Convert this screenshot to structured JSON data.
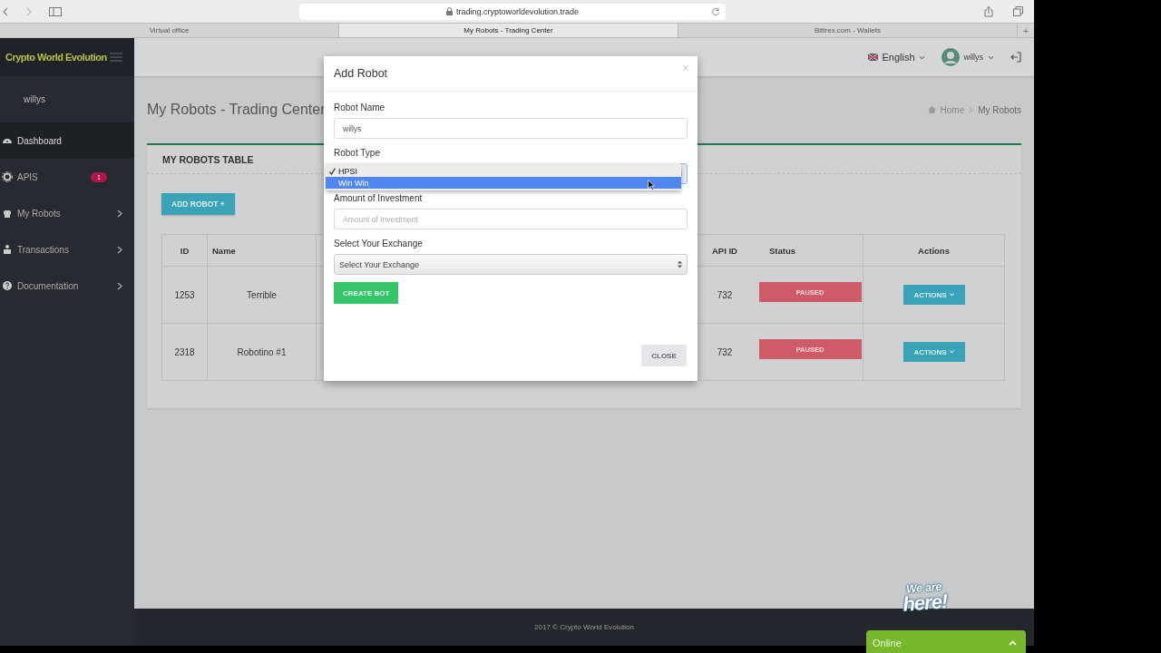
{
  "browser": {
    "url": "trading.cryptoworldevolution.trade",
    "tabs": [
      {
        "label": "Virtual office",
        "selected": false
      },
      {
        "label": "My Robots - Trading Center",
        "selected": true
      },
      {
        "label": "Bittrex.com - Wallets",
        "selected": false
      }
    ],
    "new_tab": "+"
  },
  "sidebar": {
    "brand": "Crypto World Evolution",
    "user": "willys",
    "items": [
      {
        "label": "Dashboard",
        "selected": true,
        "expandable": false
      },
      {
        "label": "APIS",
        "selected": false,
        "badge": "1",
        "expandable": false
      },
      {
        "label": "My Robots",
        "selected": false,
        "expandable": true
      },
      {
        "label": "Transactions",
        "selected": false,
        "expandable": true
      },
      {
        "label": "Documentation",
        "selected": false,
        "expandable": true
      }
    ]
  },
  "header": {
    "language": "English",
    "user": "willys"
  },
  "page": {
    "title": "My Robots - Trading Center",
    "breadcrumb": [
      "Home",
      "My Robots"
    ]
  },
  "card": {
    "title": "MY ROBOTS TABLE",
    "add_button": "ADD ROBOT +",
    "table": {
      "columns": [
        "ID",
        "Name",
        "API ID",
        "Status",
        "Actions"
      ],
      "rows": [
        {
          "id": "1253",
          "name": "Terrible",
          "api_id": "732",
          "status": "PAUSED",
          "action": "ACTIONS"
        },
        {
          "id": "2318",
          "name": "Robotino #1",
          "api_id": "732",
          "status": "PAUSED",
          "action": "ACTIONS"
        }
      ]
    }
  },
  "modal": {
    "title": "Add Robot",
    "close_icon": "×",
    "fields": [
      {
        "kind": "text",
        "label": "Robot Name",
        "value": "willys"
      },
      {
        "kind": "select-open",
        "label": "Robot Type",
        "options": [
          {
            "label": "HPSI",
            "selected": true,
            "hovered": false
          },
          {
            "label": "Win Win",
            "selected": false,
            "hovered": true
          }
        ]
      },
      {
        "kind": "text",
        "label": "Amount of Investment",
        "placeholder": "Amount of Investment"
      },
      {
        "kind": "select",
        "label": "Select Your Exchange",
        "value": "Select Your Exchange"
      }
    ],
    "submit": "CREATE BOT",
    "close": "CLOSE"
  },
  "footer": "2017 © Crypto World Evolution",
  "chat": {
    "logo_top": "We are",
    "logo_bottom": "here!",
    "status": "Online"
  }
}
